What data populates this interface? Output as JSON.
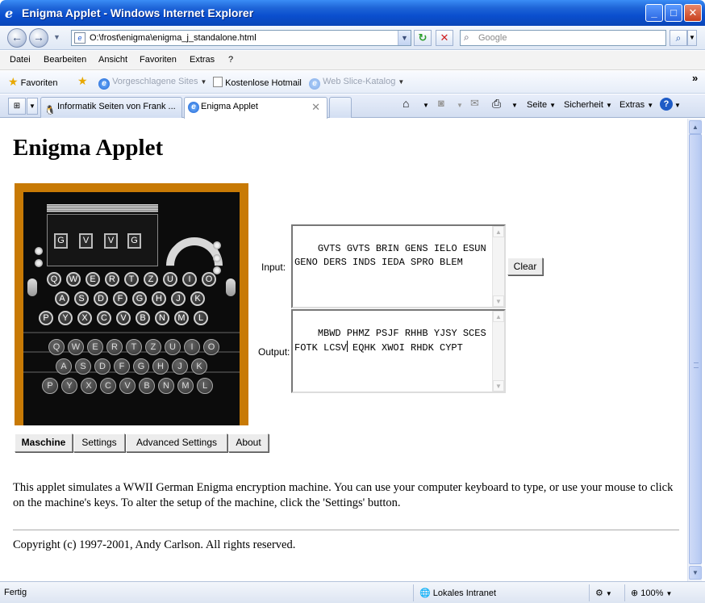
{
  "window": {
    "title": "Enigma Applet - Windows Internet Explorer"
  },
  "address": {
    "url": "O:\\frost\\enigma\\enigma_j_standalone.html",
    "search_placeholder": "Google"
  },
  "menu": [
    "Datei",
    "Bearbeiten",
    "Ansicht",
    "Favoriten",
    "Extras",
    "?"
  ],
  "favorites": {
    "label": "Favoriten",
    "suggested": "Vorgeschlagene Sites",
    "hotmail": "Kostenlose Hotmail",
    "webslice": "Web Slice-Katalog"
  },
  "tabs": [
    {
      "label": "Informatik Seiten von Frank ..."
    },
    {
      "label": "Enigma Applet"
    }
  ],
  "commandbar": {
    "page": "Seite",
    "security": "Sicherheit",
    "extras": "Extras"
  },
  "page": {
    "heading": "Enigma Applet",
    "rotors": [
      "G",
      "V",
      "V",
      "G"
    ],
    "key_rows": [
      [
        "Q",
        "W",
        "E",
        "R",
        "T",
        "Z",
        "U",
        "I",
        "O"
      ],
      [
        "A",
        "S",
        "D",
        "F",
        "G",
        "H",
        "J",
        "K"
      ],
      [
        "P",
        "Y",
        "X",
        "C",
        "V",
        "B",
        "N",
        "M",
        "L"
      ]
    ],
    "lamp_rows": [
      [
        "Q",
        "W",
        "E",
        "R",
        "T",
        "Z",
        "U",
        "I",
        "O"
      ],
      [
        "A",
        "S",
        "D",
        "F",
        "G",
        "H",
        "J",
        "K"
      ],
      [
        "P",
        "Y",
        "X",
        "C",
        "V",
        "B",
        "N",
        "M",
        "L"
      ]
    ],
    "bottom_tabs": [
      "Maschine",
      "Settings",
      "Advanced Settings",
      "About"
    ],
    "input_label": "Input:",
    "input_text": "GVTS GVTS BRIN GENS IELO ESUN\nGENO DERS INDS IEDA SPRO BLEM",
    "output_label": "Output:",
    "output_text_line1": "MBWD PHMZ PSJF RHHB YJSY SCES",
    "output_text_line2a": "FOTK LCSV",
    "output_text_line2b": " EQHK XWOI RHDK CYPT",
    "clear_label": "Clear",
    "description": "This applet simulates a WWII German Enigma encryption machine. You can use your computer keyboard to type, or use your mouse to click on the machine's keys. To alter the setup of the machine, click the 'Settings' button.",
    "copyright": "Copyright (c) 1997-2001, Andy Carlson. All rights reserved."
  },
  "status": {
    "text": "Fertig",
    "zone": "Lokales Intranet",
    "zoom": "100%"
  }
}
